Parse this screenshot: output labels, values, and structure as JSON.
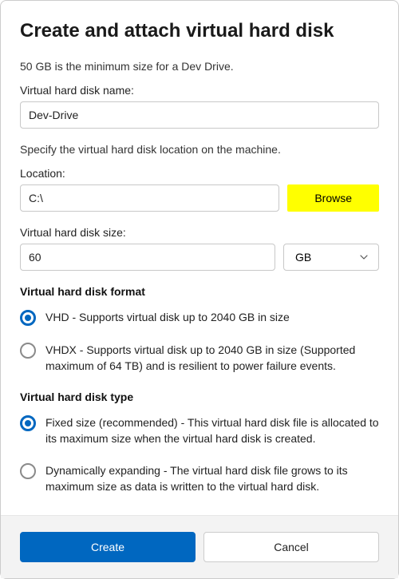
{
  "title": "Create and attach virtual hard disk",
  "min_size_hint": "50 GB is the minimum size for a Dev Drive.",
  "name_field": {
    "label": "Virtual hard disk name:",
    "value": "Dev-Drive"
  },
  "location_section": {
    "hint": "Specify the virtual hard disk location on the machine.",
    "label": "Location:",
    "value": "C:\\",
    "browse_label": "Browse"
  },
  "size_field": {
    "label": "Virtual hard disk size:",
    "value": "60",
    "unit": "GB"
  },
  "format_section": {
    "heading": "Virtual hard disk format",
    "options": [
      "VHD - Supports virtual disk up to 2040 GB in size",
      "VHDX - Supports virtual disk up to 2040 GB in size (Supported maximum of 64 TB) and is resilient to power failure events."
    ],
    "selected": 0
  },
  "type_section": {
    "heading": "Virtual hard disk type",
    "options": [
      "Fixed size (recommended) - This virtual hard disk file is allocated to its maximum size when the virtual hard disk is created.",
      "Dynamically expanding - The virtual hard disk file grows to its maximum size as data is written to the virtual hard disk."
    ],
    "selected": 0
  },
  "footer": {
    "create_label": "Create",
    "cancel_label": "Cancel"
  }
}
